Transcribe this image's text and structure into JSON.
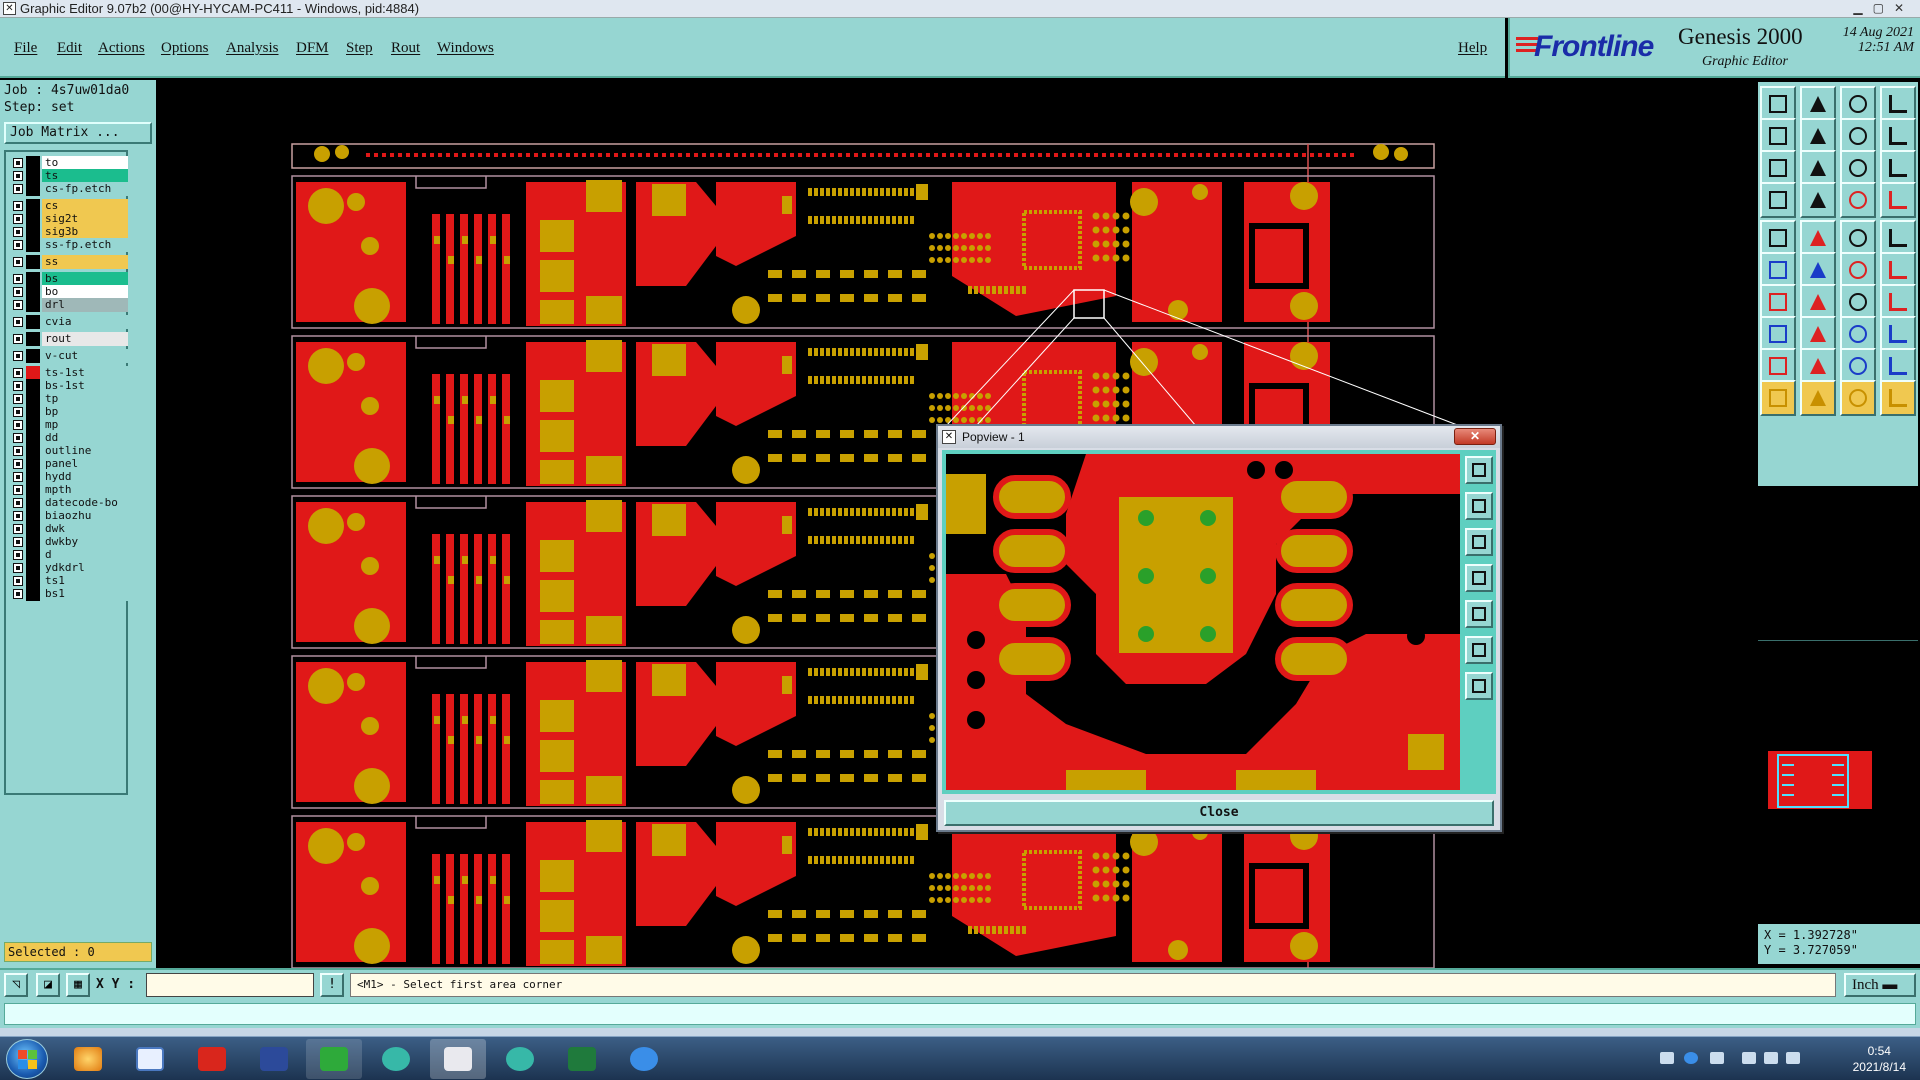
{
  "window": {
    "title": "Graphic Editor 9.07b2 (00@HY-HYCAM-PC411 - Windows, pid:4884)"
  },
  "menubar": {
    "items": [
      "File",
      "Edit",
      "Actions",
      "Options",
      "Analysis",
      "DFM",
      "Step",
      "Rout",
      "Windows"
    ],
    "help": "Help"
  },
  "brand": {
    "logo": "Frontline",
    "product": "Genesis 2000",
    "subtitle": "Graphic Editor",
    "date": "14 Aug 2021",
    "time": "12:51 AM"
  },
  "job": {
    "job_line": "Job : 4s7uw01da0",
    "step_line": "Step: set",
    "matrix_button": "Job Matrix ..."
  },
  "layers": [
    {
      "name": "to",
      "color": "#ffffff",
      "swatch": "#000000"
    },
    {
      "name": "ts",
      "color": "#1bbd8e",
      "swatch": "#000000"
    },
    {
      "name": "cs-fp.etch",
      "color": "#96d6d2",
      "swatch": "#000000"
    },
    {
      "name": "cs",
      "color": "#f0c850",
      "swatch": "#000000"
    },
    {
      "name": "sig2t",
      "color": "#f0c850",
      "swatch": "#000000"
    },
    {
      "name": "sig3b",
      "color": "#f0c850",
      "swatch": "#000000"
    },
    {
      "name": "ss-fp.etch",
      "color": "#96d6d2",
      "swatch": "#000000"
    },
    {
      "name": "ss",
      "color": "#f0c850",
      "swatch": "#000000"
    },
    {
      "name": "bs",
      "color": "#1bbd8e",
      "swatch": "#000000"
    },
    {
      "name": "bo",
      "color": "#ffffff",
      "swatch": "#000000"
    },
    {
      "name": "drl",
      "color": "#9fb8b8",
      "swatch": "#000000"
    },
    {
      "name": "cvia",
      "color": "#96d6d2",
      "swatch": "#000000"
    },
    {
      "name": "rout",
      "color": "#e8e8e8",
      "swatch": "#000000"
    },
    {
      "name": "v-cut",
      "color": "#96d6d2",
      "swatch": "#000000"
    },
    {
      "name": "ts-1st",
      "color": "#96d6d2",
      "swatch": "#e01818"
    },
    {
      "name": "bs-1st",
      "color": "#96d6d2",
      "swatch": "#000000"
    },
    {
      "name": "tp",
      "color": "#96d6d2",
      "swatch": "#000000"
    },
    {
      "name": "bp",
      "color": "#96d6d2",
      "swatch": "#000000"
    },
    {
      "name": "mp",
      "color": "#96d6d2",
      "swatch": "#000000"
    },
    {
      "name": "dd",
      "color": "#96d6d2",
      "swatch": "#000000"
    },
    {
      "name": "outline",
      "color": "#96d6d2",
      "swatch": "#000000"
    },
    {
      "name": "panel",
      "color": "#96d6d2",
      "swatch": "#000000"
    },
    {
      "name": "hydd",
      "color": "#96d6d2",
      "swatch": "#000000"
    },
    {
      "name": "mpth",
      "color": "#96d6d2",
      "swatch": "#000000"
    },
    {
      "name": "datecode-bo",
      "color": "#96d6d2",
      "swatch": "#000000"
    },
    {
      "name": "biaozhu",
      "color": "#96d6d2",
      "swatch": "#000000"
    },
    {
      "name": "dwk",
      "color": "#96d6d2",
      "swatch": "#000000"
    },
    {
      "name": "dwkby",
      "color": "#96d6d2",
      "swatch": "#000000"
    },
    {
      "name": "d",
      "color": "#96d6d2",
      "swatch": "#000000"
    },
    {
      "name": "ydkdrl",
      "color": "#96d6d2",
      "swatch": "#000000"
    },
    {
      "name": "ts1",
      "color": "#96d6d2",
      "swatch": "#000000"
    },
    {
      "name": "bs1",
      "color": "#96d6d2",
      "swatch": "#000000"
    }
  ],
  "status": {
    "selected": "Selected : 0",
    "coord_x": "X = 1.392728\"",
    "coord_y": "Y = 3.727059\""
  },
  "command": {
    "xy_label": "X Y :",
    "xy_value": "",
    "prompt": "<M1> - Select first area corner",
    "units": "Inch"
  },
  "popview": {
    "title": "Popview - 1",
    "close_label": "Close",
    "titlebar_close": "✕"
  },
  "taskbar": {
    "time": "0:54",
    "date": "2021/8/14"
  },
  "colors": {
    "panel": "#96d6d2",
    "copper_red": "#e01818",
    "pad_gold": "#c8a000",
    "via_green": "#2aa02a"
  }
}
